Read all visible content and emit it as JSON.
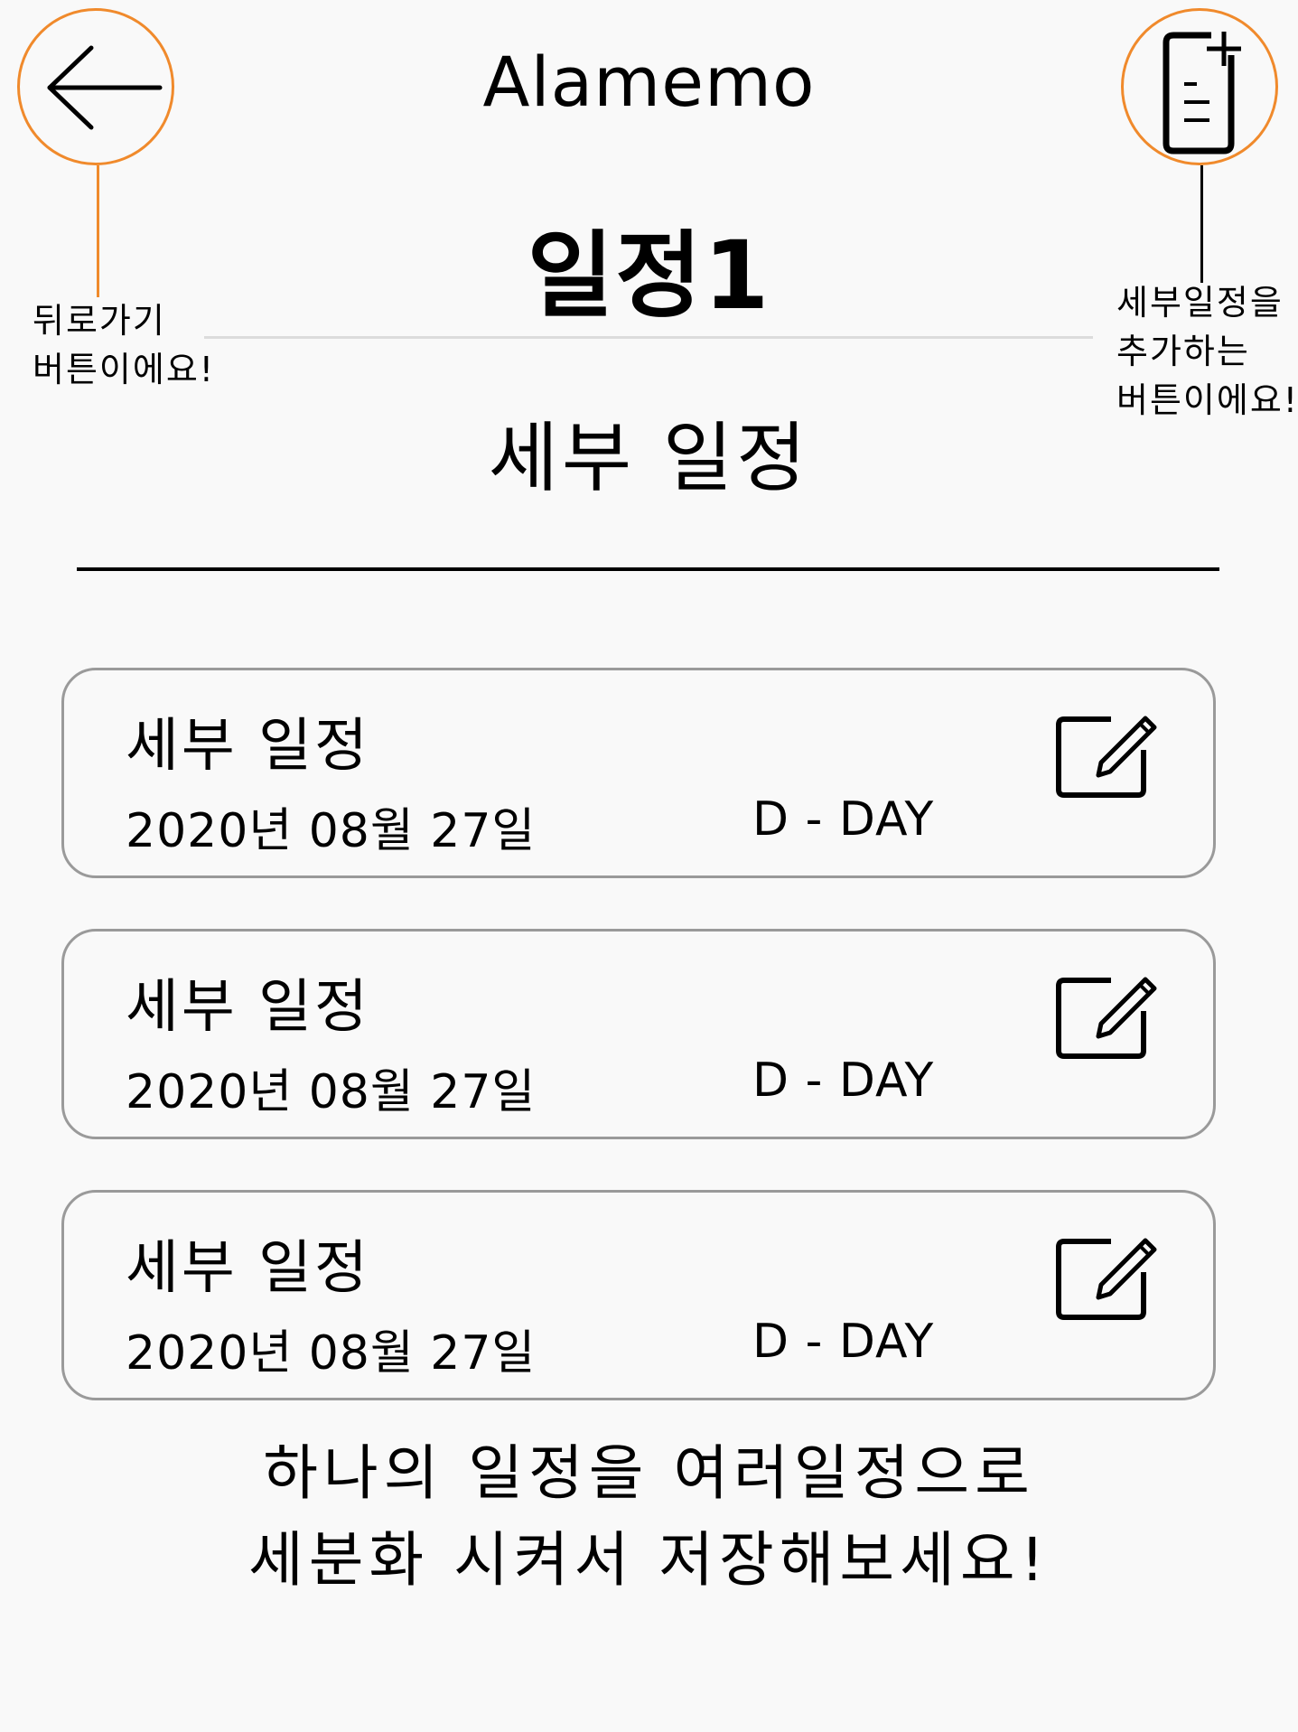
{
  "header": {
    "app_title": "Alamemo",
    "page_title": "일정1",
    "back_icon": "arrow-left-icon",
    "add_icon": "document-add-icon"
  },
  "annotations": {
    "back": [
      "뒤로가기",
      "버튼이에요!"
    ],
    "add": [
      "세부일정을",
      "추가하는",
      "버튼이에요!"
    ],
    "highlight_color": "#f08a2c"
  },
  "section": {
    "title": "세부 일정"
  },
  "cards": [
    {
      "title": "세부 일정",
      "date": "2020년 08월 27일",
      "dday": "D - DAY",
      "icon": "edit-icon"
    },
    {
      "title": "세부 일정",
      "date": "2020년 08월 27일",
      "dday": "D - DAY",
      "icon": "edit-icon"
    },
    {
      "title": "세부 일정",
      "date": "2020년 08월 27일",
      "dday": "D - DAY",
      "icon": "edit-icon"
    }
  ],
  "footer": {
    "lines": [
      "하나의 일정을 여러일정으로",
      "세분화 시켜서 저장해보세요!"
    ]
  }
}
